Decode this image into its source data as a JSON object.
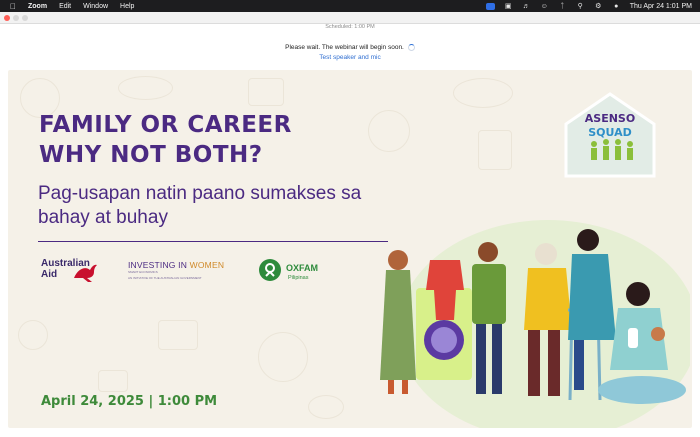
{
  "menubar": {
    "app_name": "Zoom",
    "menus": [
      "Edit",
      "Window",
      "Help"
    ],
    "clock": "Thu Apr 24  1:01 PM",
    "status_icons": [
      "zoom-status-icon",
      "camera-icon",
      "volume-icon",
      "wifi-icon",
      "bluetooth-icon",
      "search-icon",
      "control-center-icon",
      "siri-icon"
    ]
  },
  "window": {
    "scheduled": "Scheduled: 1:00 PM",
    "wait_message": "Please wait. The webinar will begin soon.",
    "test_link": "Test speaker and mic"
  },
  "banner": {
    "headline_line1": "FAMILY OR CAREER",
    "headline_line2": "WHY NOT BOTH?",
    "subhead": "Pag-usapan natin paano sumakses sa bahay at buhay",
    "badge_line1": "ASENSO",
    "badge_line2": "SQUAD",
    "logo_australian_line1": "Australian",
    "logo_australian_line2": "Aid",
    "logo_iw_a": "INVESTING IN ",
    "logo_iw_b": "WOMEN",
    "logo_iw_sub": "SMART ECONOMICS",
    "logo_iw_sub2": "AN INITIATIVE OF THE AUSTRALIAN GOVERNMENT",
    "logo_oxfam": "OXFAM",
    "logo_oxfam_sub": "Pilipinas",
    "date_time": "April 24, 2025 | 1:00 PM",
    "colors": {
      "purple": "#4b2a82",
      "green": "#3e8a3a",
      "background": "#f5f1e8"
    }
  }
}
